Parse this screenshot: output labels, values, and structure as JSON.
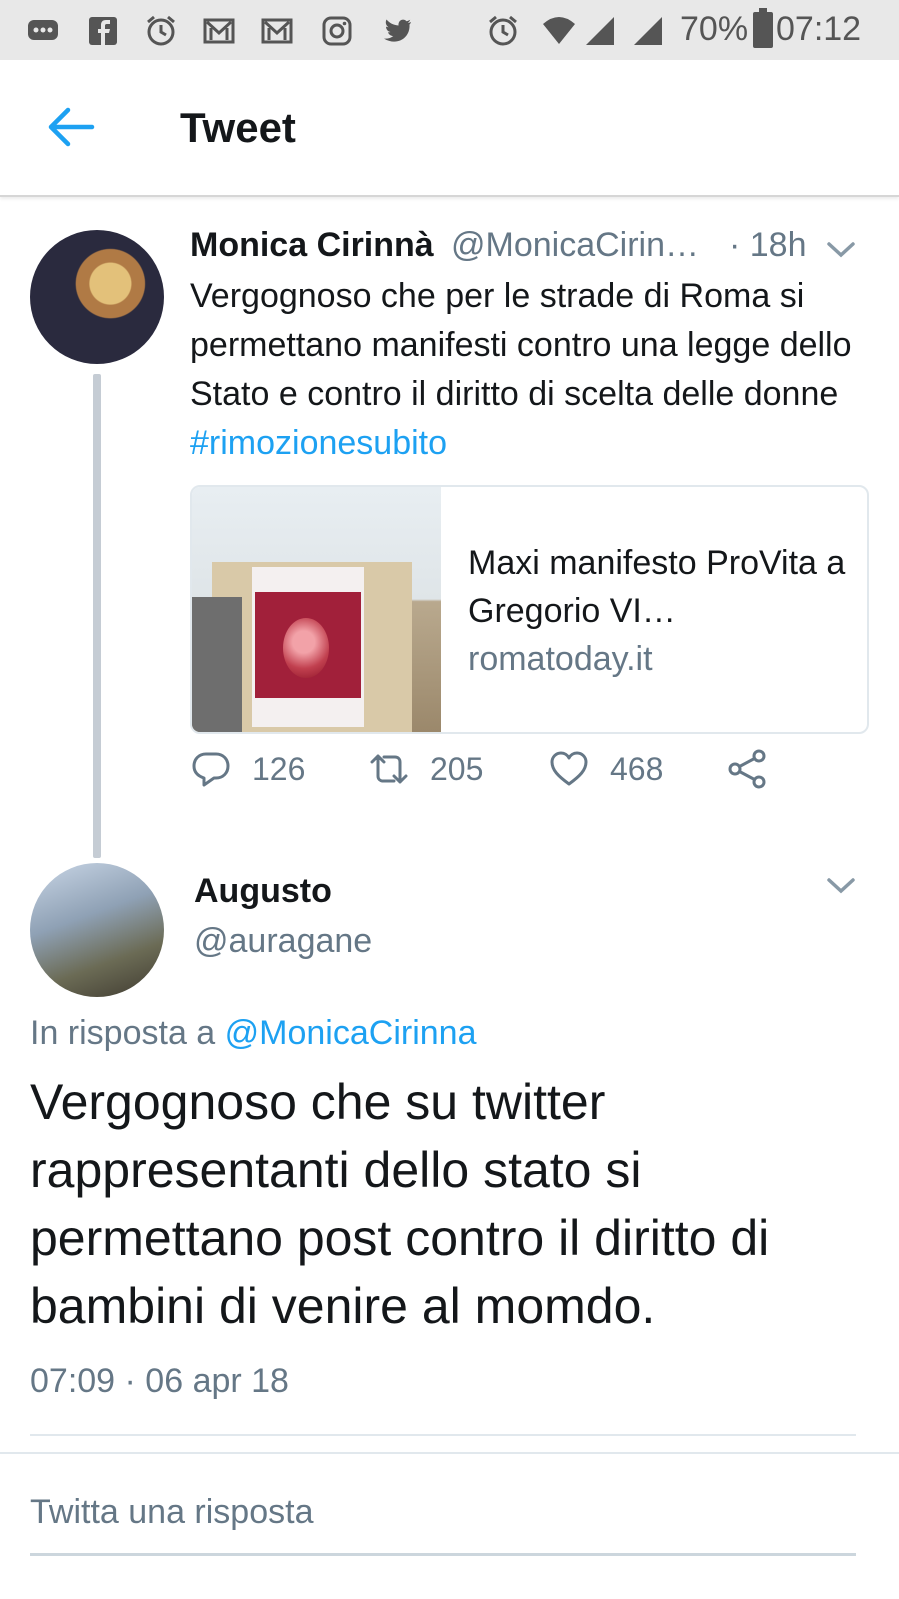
{
  "status_bar": {
    "battery": "70%",
    "time": "07:12",
    "icons_left": [
      "chat-bubble-icon",
      "facebook-icon",
      "alarm-icon",
      "gmail-icon",
      "gmail-icon",
      "instagram-icon",
      "twitter-icon"
    ],
    "icons_right": [
      "alarm-icon",
      "wifi-icon",
      "signal-icon",
      "signal-icon",
      "battery-icon"
    ]
  },
  "header": {
    "title": "Tweet",
    "back_icon": "arrow-left-icon"
  },
  "colors": {
    "accent": "#1da1f2",
    "text_primary": "#14171a",
    "text_secondary": "#657786"
  },
  "parent_tweet": {
    "name": "Monica Cirinnà",
    "handle": "@MonicaCirin…",
    "time": "· 18h",
    "text": "Vergognoso che per le strade di Roma si permettano manifesti contro una legge dello Stato e contro il diritto di scelta delle donne ",
    "hashtag": "#rimozionesubito",
    "card": {
      "title": "Maxi manifesto ProVita a Gregorio VI…",
      "domain": "romatoday.it"
    },
    "actions": {
      "replies": "126",
      "retweets": "205",
      "likes": "468"
    }
  },
  "main_tweet": {
    "name": "Augusto",
    "handle": "@auragane",
    "reply_to_label": "In risposta a ",
    "reply_to_mention": "@MonicaCirinna",
    "text": "Vergognoso che su twitter rappresentanti dello stato si permettano post contro il diritto di bambini di venire al momdo.",
    "timestamp": "07:09 · 06 apr 18"
  },
  "reply_box": {
    "placeholder": "Twitta una risposta"
  }
}
